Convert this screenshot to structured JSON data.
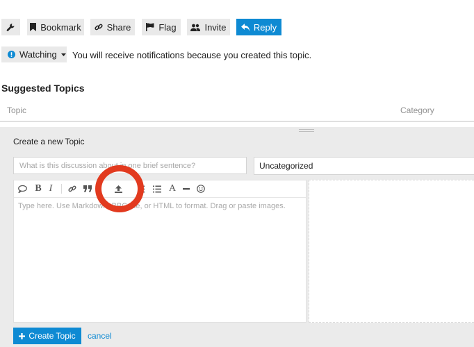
{
  "topic_actions": {
    "admin_icon": "wrench-icon",
    "bookmark": "Bookmark",
    "share": "Share",
    "flag": "Flag",
    "invite": "Invite",
    "reply": "Reply"
  },
  "notifications": {
    "level": "Watching",
    "message": "You will receive notifications because you created this topic."
  },
  "suggested": {
    "title": "Suggested Topics",
    "columns": [
      "Topic",
      "Category"
    ]
  },
  "composer": {
    "title": "Create a new Topic",
    "title_placeholder": "What is this discussion about in one brief sentence?",
    "category": "Uncategorized",
    "body_placeholder": "Type here. Use Markdown, BBCode, or HTML to format. Drag or paste images.",
    "toolbar": [
      "quote-icon",
      "bold-icon",
      "italic-icon",
      "link-icon",
      "blockquote-icon",
      "upload-icon",
      "bullet-list-icon",
      "numbered-list-icon",
      "heading-icon",
      "horizontal-rule-icon",
      "emoji-icon"
    ],
    "submit_label": "Create Topic",
    "cancel_label": "cancel"
  },
  "colors": {
    "primary": "#0e8ad3",
    "button_bg": "#e9e9e9",
    "annotation_circle": "#e23a1f"
  }
}
